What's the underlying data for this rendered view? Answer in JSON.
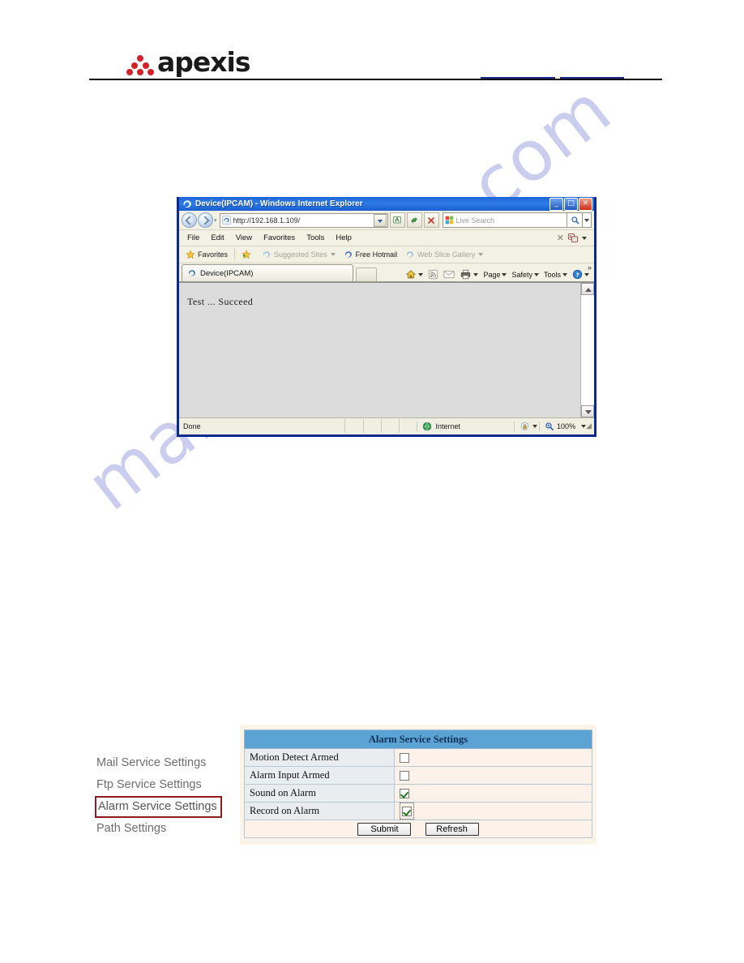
{
  "page": {
    "watermark": "manualshive.com"
  },
  "header": {
    "logo_text": "apexis",
    "logo_mark": "apexis-triangle-dots",
    "links": [
      {
        "label": ""
      },
      {
        "label": ""
      }
    ]
  },
  "browser": {
    "title": "Device(IPCAM) - Windows Internet Explorer",
    "window_buttons": {
      "minimize": "_",
      "maximize": "□",
      "close": "✕"
    },
    "address": {
      "url": "http://192.168.1.109/",
      "back_label": "Back",
      "forward_label": "Forward",
      "refresh_label": "Refresh",
      "stop_label": "Stop",
      "compat_label": "Compatibility View"
    },
    "search": {
      "placeholder": "Live Search",
      "provider": "Live Search"
    },
    "menu": [
      "File",
      "Edit",
      "View",
      "Favorites",
      "Tools",
      "Help"
    ],
    "favorites_bar": [
      {
        "label": "Favorites",
        "dim": false
      },
      {
        "label": "Suggested Sites",
        "dim": true
      },
      {
        "label": "Free Hotmail",
        "dim": false
      },
      {
        "label": "Web Slice Gallery",
        "dim": true
      }
    ],
    "tab": {
      "label": "Device(IPCAM)"
    },
    "command_bar": [
      "Page",
      "Safety",
      "Tools"
    ],
    "command_overflow": "»",
    "page_content": "Test  ...  Succeed",
    "status": {
      "text": "Done",
      "zone": "Internet",
      "zoom": "100%"
    }
  },
  "settings_menu": {
    "items": [
      {
        "label": "Mail Service Settings",
        "selected": false
      },
      {
        "label": "Ftp Service Settings",
        "selected": false
      },
      {
        "label": "Alarm Service Settings",
        "selected": true
      },
      {
        "label": "Path Settings",
        "selected": false
      }
    ]
  },
  "alarm_panel": {
    "title": "Alarm Service Settings",
    "rows": [
      {
        "label": "Motion Detect Armed",
        "checked": false,
        "focused": false
      },
      {
        "label": "Alarm Input Armed",
        "checked": false,
        "focused": false
      },
      {
        "label": "Sound on Alarm",
        "checked": true,
        "focused": false
      },
      {
        "label": "Record on Alarm",
        "checked": true,
        "focused": true
      }
    ],
    "buttons": {
      "submit": "Submit",
      "refresh": "Refresh"
    }
  },
  "colors": {
    "accent_blue": "#5ba3d4",
    "panel_cream": "#fdf4e9",
    "label_cell": "#e9edf0",
    "selection_red": "#8d1d1d",
    "logo_red": "#d2232a",
    "link_blue": "#1a2a8a",
    "watermark": "#c9cbee"
  }
}
